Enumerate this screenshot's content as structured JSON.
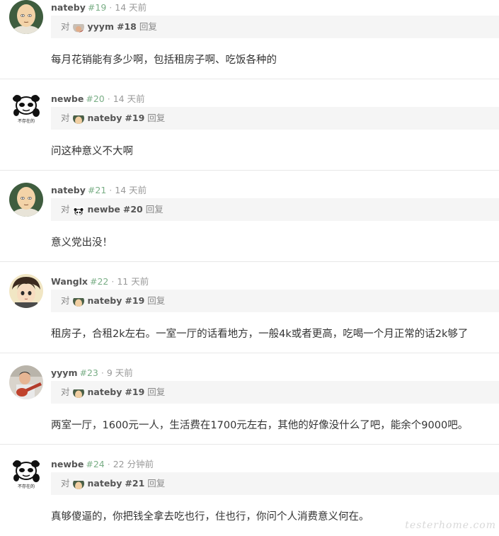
{
  "replies": [
    {
      "author": "nateby",
      "floor": "#19",
      "dot": "·",
      "time": "14 天前",
      "avatar": "saitama-avatar",
      "quote": {
        "prefix": "对",
        "author": "yyym",
        "floor": "#18",
        "suffix": "回复",
        "avatar": "yyym-mini-avatar"
      },
      "content": "每月花销能有多少啊，包括租房子啊、吃饭各种的"
    },
    {
      "author": "newbe",
      "floor": "#20",
      "dot": "·",
      "time": "14 天前",
      "avatar": "panda-meme-avatar",
      "quote": {
        "prefix": "对",
        "author": "nateby",
        "floor": "#19",
        "suffix": "回复",
        "avatar": "nateby-mini-avatar"
      },
      "content": "问这种意义不大啊"
    },
    {
      "author": "nateby",
      "floor": "#21",
      "dot": "·",
      "time": "14 天前",
      "avatar": "saitama-avatar",
      "quote": {
        "prefix": "对",
        "author": "newbe",
        "floor": "#20",
        "suffix": "回复",
        "avatar": "newbe-mini-avatar"
      },
      "content": "意义党出没！"
    },
    {
      "author": "Wanglx",
      "floor": "#22",
      "dot": "·",
      "time": "11 天前",
      "avatar": "anime-boy-avatar",
      "quote": {
        "prefix": "对",
        "author": "nateby",
        "floor": "#19",
        "suffix": "回复",
        "avatar": "nateby-mini-avatar"
      },
      "content": "租房子，合租2k左右。一室一厅的话看地方，一般4k或者更高，吃喝一个月正常的话2k够了"
    },
    {
      "author": "yyym",
      "floor": "#23",
      "dot": "·",
      "time": "9 天前",
      "avatar": "guitar-player-avatar",
      "quote": {
        "prefix": "对",
        "author": "nateby",
        "floor": "#19",
        "suffix": "回复",
        "avatar": "nateby-mini-avatar"
      },
      "content": "两室一厅，1600元一人，生活费在1700元左右，其他的好像没什么了吧，能余个9000吧。"
    },
    {
      "author": "newbe",
      "floor": "#24",
      "dot": "·",
      "time": "22 分钟前",
      "avatar": "panda-meme-avatar",
      "quote": {
        "prefix": "对",
        "author": "nateby",
        "floor": "#21",
        "suffix": "回复",
        "avatar": "nateby-mini-avatar"
      },
      "content": "真够傻逼的，你把钱全拿去吃也行，住也行，你问个人消费意义何在。"
    }
  ],
  "panda_caption": "不存在的",
  "watermark": "testerhome.com",
  "colors": {
    "floor": "#7aae86",
    "quote_bg": "#f5f5f5",
    "divider": "#e8e8e8"
  }
}
